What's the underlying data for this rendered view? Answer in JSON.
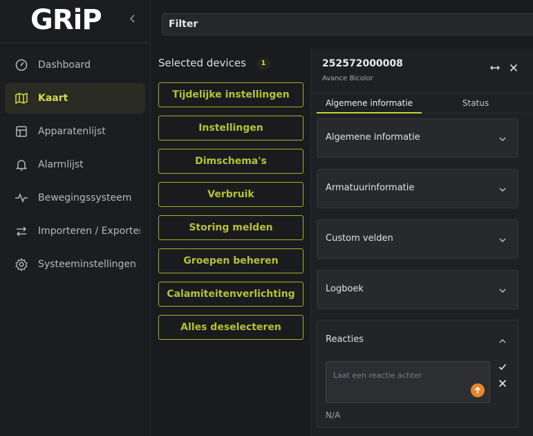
{
  "app": {
    "logo_text": "GRiP",
    "colors": {
      "accent": "#c8d43a",
      "upload": "#e8862a"
    }
  },
  "sidebar": {
    "collapse_icon": "chevron-left-icon",
    "items": [
      {
        "label": "Dashboard",
        "icon": "gauge-icon",
        "active": false
      },
      {
        "label": "Kaart",
        "icon": "map-icon",
        "active": true
      },
      {
        "label": "Apparatenlijst",
        "icon": "table-icon",
        "active": false
      },
      {
        "label": "Alarmlijst",
        "icon": "bell-icon",
        "active": false
      },
      {
        "label": "Bewegingssysteem",
        "icon": "activity-icon",
        "active": false
      },
      {
        "label": "Importeren / Exporteren",
        "icon": "swap-icon",
        "active": false
      },
      {
        "label": "Systeeminstellingen",
        "icon": "gear-icon",
        "active": false
      }
    ]
  },
  "filter": {
    "label": "Filter"
  },
  "selected": {
    "title": "Selected devices",
    "count": "1",
    "actions": [
      "Tijdelijke instellingen",
      "Instellingen",
      "Dimschema's",
      "Verbruik",
      "Storing melden",
      "Groepen beheren",
      "Calamiteitenverlichting",
      "Alles deselecteren"
    ]
  },
  "detail": {
    "device_id": "252572000008",
    "device_type": "Avance Bicolor",
    "tabs": [
      {
        "label": "Algemene informatie",
        "active": true
      },
      {
        "label": "Status",
        "active": false
      }
    ],
    "sections": [
      "Algemene informatie",
      "Armatuurinformatie",
      "Custom velden",
      "Logboek"
    ],
    "reacties": {
      "label": "Reacties",
      "placeholder": "Laat een reactie achter",
      "empty_text": "N/A"
    }
  }
}
